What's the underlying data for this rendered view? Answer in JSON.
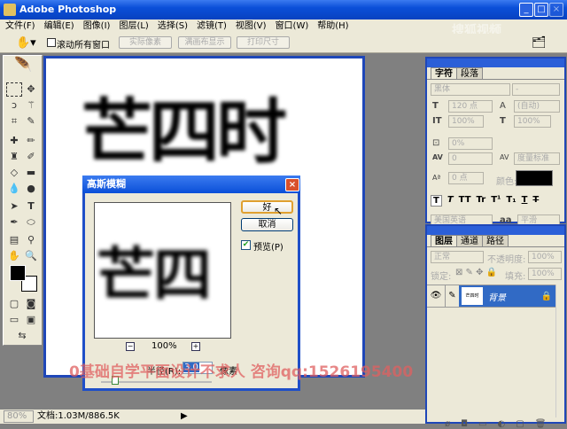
{
  "window": {
    "title": "Adobe Photoshop"
  },
  "menu": [
    "文件(F)",
    "编辑(E)",
    "图像(I)",
    "图层(L)",
    "选择(S)",
    "滤镜(T)",
    "视图(V)",
    "窗口(W)",
    "帮助(H)"
  ],
  "options": {
    "scroll_all": "滚动所有窗口",
    "actual_pixels": "实际像素",
    "fit_screen": "满画布显示",
    "print_size": "打印尺寸"
  },
  "watermark_logo": "搜狐视频 tv.sohu.com",
  "document": {
    "text": "芒四时",
    "zoom": "80%",
    "doc_size": "文档:1.03M/886.5K"
  },
  "dialog": {
    "title": "高斯模糊",
    "ok": "好",
    "cancel": "取消",
    "preview_label": "预览(P)",
    "preview_checked": true,
    "zoom": "100%",
    "radius_label": "半径(R):",
    "radius_value": "3.0",
    "unit": "像素",
    "preview_text": "芒四"
  },
  "character_panel": {
    "tabs": [
      "字符",
      "段落"
    ],
    "font": "黑体",
    "style": "-",
    "size": "120 点",
    "leading": "(自动)",
    "vscale": "100%",
    "hscale": "100%",
    "tracking_pct": "0%",
    "kerning": "0",
    "kerning_mode": "度量标准",
    "baseline": "0 点",
    "color_label": "颜色:",
    "color": "#000000",
    "language": "美国英语",
    "aa": "平滑",
    "style_buttons": [
      "T",
      "T",
      "TT",
      "Tr",
      "T¹",
      "T₁",
      "T",
      "T"
    ]
  },
  "layers_panel": {
    "tabs": [
      "图层",
      "通道",
      "路径"
    ],
    "blend": "正常",
    "opacity_label": "不透明度:",
    "opacity": "100%",
    "lock_label": "锁定:",
    "fill_label": "填充:",
    "fill": "100%",
    "layers": [
      {
        "name": "背景",
        "thumb": "芒四时"
      }
    ]
  },
  "overlay": "0基础自学平面设计不求人 咨询qq:1526195400"
}
